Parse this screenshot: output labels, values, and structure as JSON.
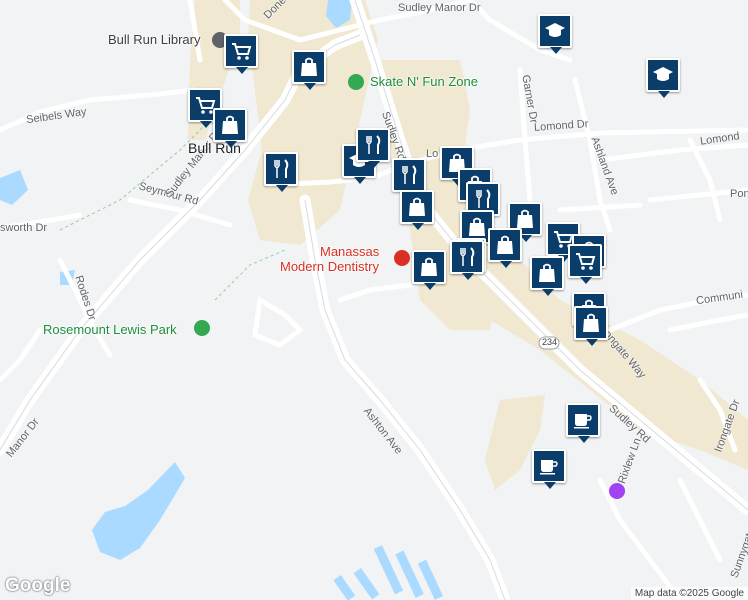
{
  "roads": {
    "sudley_manor_dr_top": "Sudley Manor Dr",
    "sudley_manor_dr_left": "Sudley Manor Dr",
    "manor_dr": "Manor Dr",
    "seibels_way": "Seibels Way",
    "seymour_rd": "Seymour Rd",
    "worth_dr": "sworth Dr",
    "rodes_dr": "Rodes Dr",
    "sudley_rd_upper": "Sudley Rd",
    "sudley_rd_lower": "Sudley Rd",
    "route_badge": "234",
    "lomond_dr": "Lomond Dr",
    "lomond_dr_right": "Lomond",
    "garner_dr": "Garner Dr",
    "ashland_ave": "Ashland Ave",
    "irongate_way": "Irongate Way",
    "ashton_ave": "Ashton Ave",
    "rixlew_ln": "Rixlew Ln",
    "sunnygate_dr": "Sunnygate Dr",
    "irongate_dr": "Irongate Dr",
    "communi": "Communi",
    "pon": "Pon",
    "done": "Done",
    "lo": "Lo"
  },
  "places": {
    "library": "Bull Run Library",
    "skate": "Skate N' Fun Zone",
    "dentistry_line1": "Manassas",
    "dentistry_line2": "Modern Dentistry",
    "park": "Rosemount Lewis Park",
    "area": "Bull Run"
  },
  "markers": [
    {
      "icon": "cart-icon"
    },
    {
      "icon": "shopping-bag-icon"
    },
    {
      "icon": "cart-icon"
    },
    {
      "icon": "shopping-bag-icon"
    },
    {
      "icon": "restaurant-icon"
    },
    {
      "icon": "school-icon"
    },
    {
      "icon": "school-icon"
    },
    {
      "icon": "school-icon"
    },
    {
      "icon": "restaurant-icon"
    },
    {
      "icon": "shopping-bag-icon"
    },
    {
      "icon": "restaurant-icon"
    },
    {
      "icon": "shopping-bag-icon"
    },
    {
      "icon": "shopping-bag-icon"
    },
    {
      "icon": "restaurant-icon"
    },
    {
      "icon": "shopping-bag-icon"
    },
    {
      "icon": "shopping-bag-icon"
    },
    {
      "icon": "shopping-bag-icon"
    },
    {
      "icon": "shopping-bag-icon"
    },
    {
      "icon": "cart-icon"
    },
    {
      "icon": "shopping-bag-icon"
    },
    {
      "icon": "cart-icon"
    },
    {
      "icon": "shopping-bag-icon"
    },
    {
      "icon": "restaurant-icon"
    },
    {
      "icon": "shopping-bag-icon"
    },
    {
      "icon": "shopping-bag-icon"
    },
    {
      "icon": "shopping-bag-icon"
    },
    {
      "icon": "cafe-icon"
    },
    {
      "icon": "cafe-icon"
    }
  ],
  "colors": {
    "marker": "#0b3d6b",
    "park_green": "#34a853",
    "dentist_red": "#d93025",
    "water": "#aadaff",
    "commercial": "#f0e8d0"
  },
  "branding": {
    "logo": "Google",
    "attribution": "Map data ©2025 Google"
  }
}
